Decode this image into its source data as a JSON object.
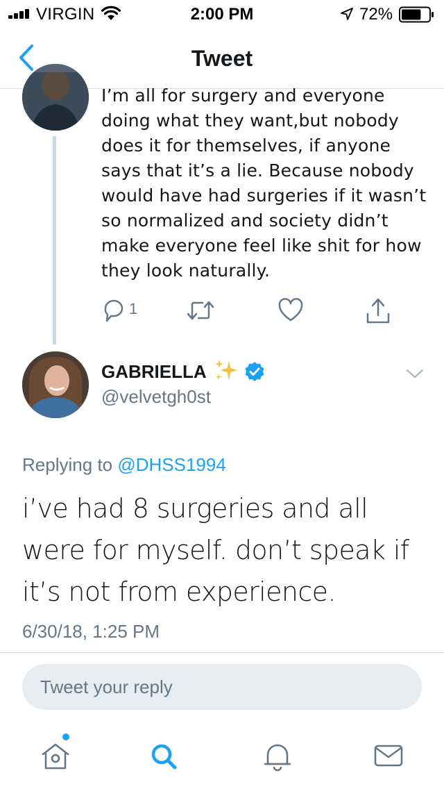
{
  "status_bar": {
    "carrier": "VIRGIN",
    "time": "2:00 PM",
    "battery_percent": "72%",
    "battery_level": 0.72,
    "signal_bars": 4,
    "icons": [
      "signal-icon",
      "wifi-icon",
      "location-arrow-icon",
      "battery-icon"
    ]
  },
  "nav": {
    "title": "Tweet",
    "back_icon": "chevron-left-icon"
  },
  "parent_tweet": {
    "text": "I’m all for surgery and everyone doing what they want,but nobody does it for themselves, if anyone says that it’s a lie. Because nobody would have had surgeries if it wasn’t so normalized and society didn’t make everyone feel like shit for how they look naturally.",
    "reply_count": "1",
    "actions": [
      "reply-icon",
      "retweet-icon",
      "like-icon",
      "share-icon"
    ]
  },
  "tweet": {
    "author_name": "GABRIELLA",
    "author_handle": "@velvetgh0st",
    "verified": true,
    "name_emoji": "sparkles-icon",
    "replying_prefix": "Replying to",
    "replying_to": "@DHSS1994",
    "body": "i’ve had 8 surgeries and all were for myself. don’t speak if it’s not from experience.",
    "timestamp": "6/30/18, 1:25 PM"
  },
  "reply_box": {
    "placeholder": "Tweet your reply"
  },
  "tab_bar": {
    "tabs": [
      "home-icon",
      "search-icon",
      "notifications-icon",
      "messages-icon"
    ],
    "active": "search-icon",
    "home_has_new": true
  },
  "colors": {
    "accent": "#1da1f2",
    "text": "#14171a",
    "secondary": "#657786",
    "thread_line": "#ccd6dd",
    "reply_box_bg": "#e6ecf0"
  }
}
